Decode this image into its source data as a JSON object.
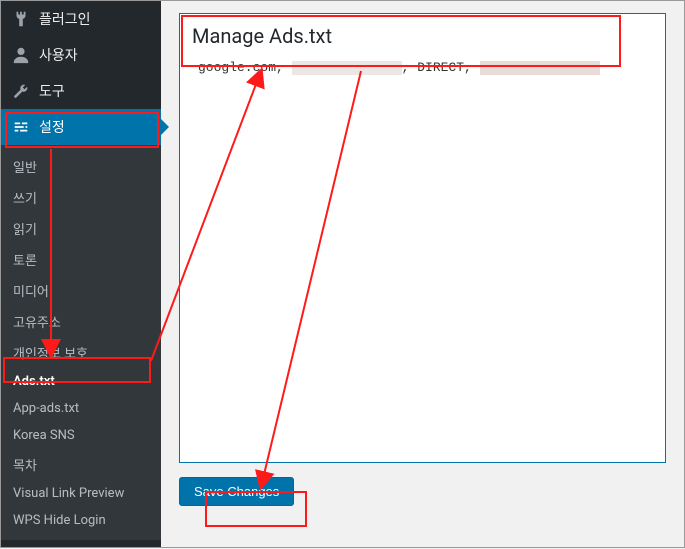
{
  "sidebar": {
    "top": [
      {
        "label": "플러그인",
        "icon": "plug"
      },
      {
        "label": "사용자",
        "icon": "user"
      },
      {
        "label": "도구",
        "icon": "wrench"
      }
    ],
    "settings_label": "설정",
    "submenu": [
      {
        "label": "일반"
      },
      {
        "label": "쓰기"
      },
      {
        "label": "읽기"
      },
      {
        "label": "토론"
      },
      {
        "label": "미디어"
      },
      {
        "label": "고유주소"
      },
      {
        "label": "개인정보 보호"
      },
      {
        "label": "Ads.txt",
        "current": true
      },
      {
        "label": "App-ads.txt"
      },
      {
        "label": "Korea SNS"
      },
      {
        "label": "목차"
      },
      {
        "label": "Visual Link Preview"
      },
      {
        "label": "WPS Hide Login"
      }
    ]
  },
  "page": {
    "title": "Manage Ads.txt",
    "ads_segments": {
      "a": "google.com, ",
      "b": ", DIRECT, "
    },
    "save_label": "Save Changes"
  }
}
